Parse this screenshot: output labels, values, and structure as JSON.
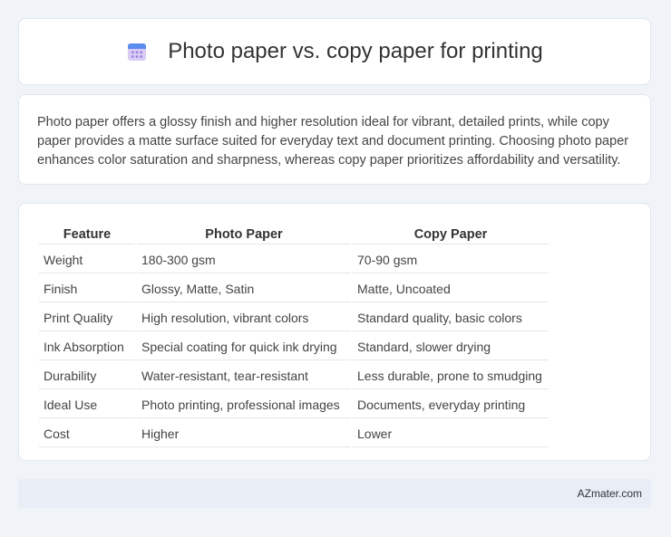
{
  "header": {
    "title": "Photo paper vs. copy paper for printing",
    "icon": "calendar-icon"
  },
  "intro": {
    "text": "Photo paper offers a glossy finish and higher resolution ideal for vibrant, detailed prints, while copy paper provides a matte surface suited for everyday text and document printing. Choosing photo paper enhances color saturation and sharpness, whereas copy paper prioritizes affordability and versatility."
  },
  "table": {
    "headers": [
      "Feature",
      "Photo Paper",
      "Copy Paper"
    ],
    "rows": [
      [
        "Weight",
        "180-300 gsm",
        "70-90 gsm"
      ],
      [
        "Finish",
        "Glossy, Matte, Satin",
        "Matte, Uncoated"
      ],
      [
        "Print Quality",
        "High resolution, vibrant colors",
        "Standard quality, basic colors"
      ],
      [
        "Ink Absorption",
        "Special coating for quick ink drying",
        "Standard, slower drying"
      ],
      [
        "Durability",
        "Water-resistant, tear-resistant",
        "Less durable, prone to smudging"
      ],
      [
        "Ideal Use",
        "Photo printing, professional images",
        "Documents, everyday printing"
      ],
      [
        "Cost",
        "Higher",
        "Lower"
      ]
    ]
  },
  "footer": {
    "site": "AZmater.com"
  },
  "colors": {
    "background": "#f0f3f8",
    "card": "#ffffff",
    "footer_bg": "#e8edf6",
    "icon_top": "#5b8def",
    "icon_body": "#c9b8f2"
  }
}
